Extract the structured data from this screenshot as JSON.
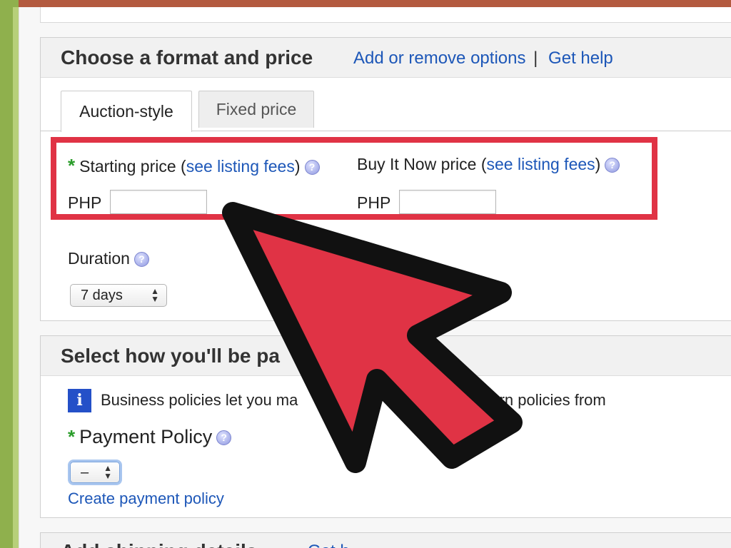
{
  "format_section": {
    "title": "Choose a format and price",
    "add_remove_link": "Add or remove options",
    "separator": "|",
    "get_help_link": "Get help",
    "tabs": [
      {
        "label": "Auction-style",
        "active": true
      },
      {
        "label": "Fixed price",
        "active": false
      }
    ],
    "starting_price": {
      "required_mark": "*",
      "label": "Starting price",
      "paren_open": "(",
      "fees_link": "see listing fees",
      "paren_close": ")",
      "currency": "PHP",
      "value": ""
    },
    "buy_it_now": {
      "label": "Buy It Now price",
      "paren_open": "(",
      "fees_link": "see listing fees",
      "paren_close": ")",
      "currency": "PHP",
      "value": ""
    },
    "duration": {
      "label": "Duration",
      "selected": "7 days"
    },
    "help_glyph": "?"
  },
  "payment_section": {
    "title": "Select how you'll be pa",
    "info_glyph": "i",
    "info_text_start": "Business policies let you ma",
    "info_text_mid": "r p",
    "info_text_end": "ping, and return policies from",
    "payment_policy": {
      "required_mark": "*",
      "label": "Payment Policy",
      "selected": "–"
    },
    "create_link": "Create payment policy"
  },
  "shipping_section": {
    "title": "Add shipping details",
    "link": "Get h"
  },
  "colors": {
    "highlight": "#e03345",
    "arrow_fill": "#e03345",
    "link": "#1d57b8",
    "required": "#2a9d2a"
  }
}
